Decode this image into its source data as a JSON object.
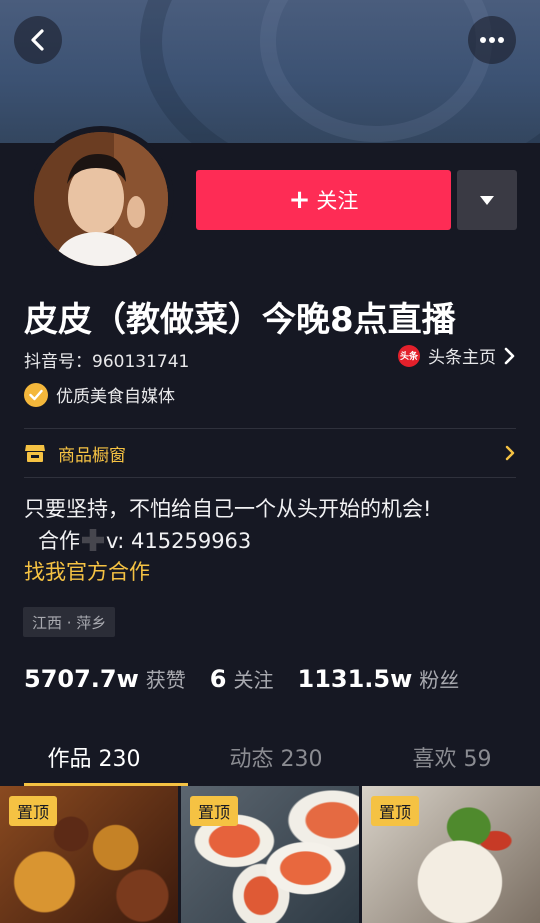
{
  "header": {
    "back_icon": "chevron-left-icon",
    "more_icon": "more-horizontal-icon"
  },
  "profile": {
    "name": "皮皮（教做菜）今晚8点直播",
    "douyin_id": "抖音号：960131741",
    "toutiao_logo_text": "头条",
    "toutiao_link": "头条主页",
    "verified_text": "优质美食自媒体"
  },
  "actions": {
    "follow_plus": "+",
    "follow_label": "关注"
  },
  "shop": {
    "label": "商品橱窗"
  },
  "bio": {
    "line1": "只要坚持，不怕给自己一个从头开始的机会!",
    "line2_prefix": "合作",
    "line2_suffix": "v: 415259963",
    "official_link": "找我官方合作"
  },
  "location": "江西 · 萍乡",
  "stats": [
    {
      "value": "5707.7w",
      "label": "获赞"
    },
    {
      "value": "6",
      "label": "关注"
    },
    {
      "value": "1131.5w",
      "label": "粉丝"
    }
  ],
  "tabs": [
    {
      "label": "作品 230"
    },
    {
      "label": "动态 230"
    },
    {
      "label": "喜欢 59"
    }
  ],
  "videos": [
    {
      "badge": "置顶"
    },
    {
      "badge": "置顶"
    },
    {
      "badge": "置顶"
    }
  ],
  "colors": {
    "background": "#161823",
    "follow": "#fe2c55",
    "accent_yellow": "#f5c243"
  }
}
